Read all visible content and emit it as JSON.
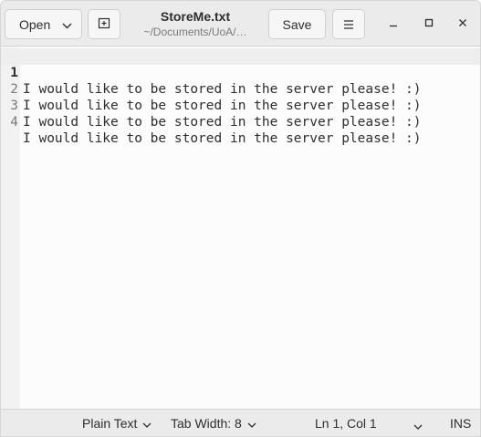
{
  "header": {
    "open_label": "Open",
    "save_label": "Save",
    "title": "StoreMe.txt",
    "subtitle": "~/Documents/UoA/…"
  },
  "editor": {
    "lines": [
      {
        "number": "1",
        "text": "I would like to be stored in the server please! :)"
      },
      {
        "number": "2",
        "text": "I would like to be stored in the server please! :)"
      },
      {
        "number": "3",
        "text": "I would like to be stored in the server please! :)"
      },
      {
        "number": "4",
        "text": "I would like to be stored in the server please! :)"
      }
    ]
  },
  "statusbar": {
    "language": "Plain Text",
    "tab_width": "Tab Width: 8",
    "position": "Ln 1, Col 1",
    "mode": "INS"
  },
  "icons": {
    "open_dropdown": "chevron-down-icon",
    "new_tab": "new-tab-icon",
    "menu": "hamburger-menu-icon",
    "minimize": "minimize-icon",
    "maximize": "maximize-icon",
    "close": "close-icon"
  }
}
